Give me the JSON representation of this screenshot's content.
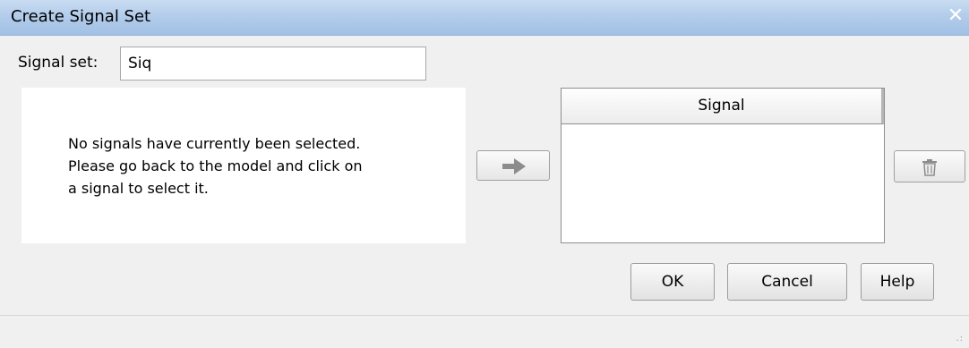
{
  "window": {
    "title": "Create Signal Set",
    "close_glyph": "✕"
  },
  "signal_set": {
    "label": "Signal set:",
    "value": "Siq"
  },
  "info_panel": {
    "message": "No signals have currently been selected.\nPlease go back to the model and click on\na signal to select it."
  },
  "signal_table": {
    "column_header": "Signal",
    "rows": []
  },
  "icons": {
    "add_button": "right-arrow-icon",
    "delete_button": "trash-icon"
  },
  "buttons": {
    "ok": "OK",
    "cancel": "Cancel",
    "help": "Help"
  }
}
